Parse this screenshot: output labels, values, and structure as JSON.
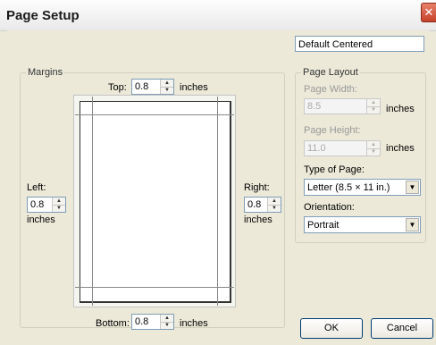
{
  "window": {
    "title": "Page Setup"
  },
  "preset": {
    "value": "Default Centered"
  },
  "margins": {
    "legend": "Margins",
    "top": {
      "label": "Top:",
      "value": "0.8",
      "unit": "inches"
    },
    "bottom": {
      "label": "Bottom:",
      "value": "0.8",
      "unit": "inches"
    },
    "left": {
      "label": "Left:",
      "value": "0.8",
      "unit": "inches"
    },
    "right": {
      "label": "Right:",
      "value": "0.8",
      "unit": "inches"
    }
  },
  "layout": {
    "legend": "Page Layout",
    "width": {
      "label": "Page Width:",
      "value": "8.5",
      "unit": "inches"
    },
    "height": {
      "label": "Page Height:",
      "value": "11.0",
      "unit": "inches"
    },
    "type": {
      "label": "Type of Page:",
      "value": "Letter (8.5 × 11 in.)"
    },
    "orientation": {
      "label": "Orientation:",
      "value": "Portrait"
    }
  },
  "buttons": {
    "ok": "OK",
    "cancel": "Cancel"
  },
  "icons": {
    "close": "close-icon",
    "spin_up": "arrow-up-icon",
    "spin_down": "arrow-down-icon",
    "dropdown": "chevron-down-icon"
  }
}
